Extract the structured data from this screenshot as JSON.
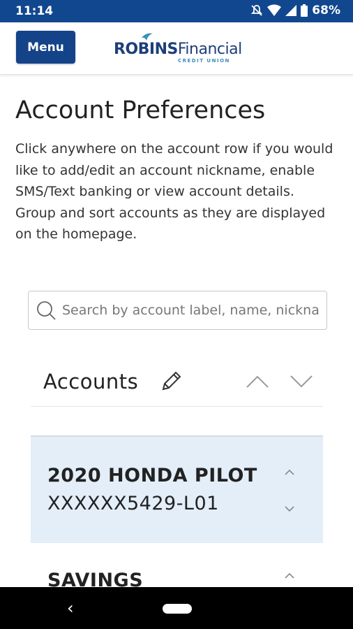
{
  "status_bar": {
    "time": "11:14",
    "battery": "68%",
    "icons": [
      "do-not-disturb-icon",
      "wifi-icon",
      "signal-icon",
      "battery-icon"
    ]
  },
  "header": {
    "menu_label": "Menu",
    "logo_text_bold": "ROBINS",
    "logo_text_regular": "Financial",
    "logo_subtitle": "CREDIT UNION"
  },
  "page": {
    "title": "Account Preferences",
    "description": "Click anywhere on the account row if you would like to add/edit an account nickname, enable SMS/Text banking or view account details. Group and sort accounts as they are displayed on the homepage."
  },
  "search": {
    "placeholder": "Search by account label, name, nickname or number"
  },
  "group": {
    "label": "Accounts"
  },
  "accounts": [
    {
      "name": "2020 HONDA PILOT",
      "number": "XXXXXX5429-L01"
    },
    {
      "name": "SAVINGS",
      "number": ""
    }
  ],
  "colors": {
    "status_bar": "#11478f",
    "menu_button": "#15438a",
    "selected_row": "#e3eef9"
  }
}
